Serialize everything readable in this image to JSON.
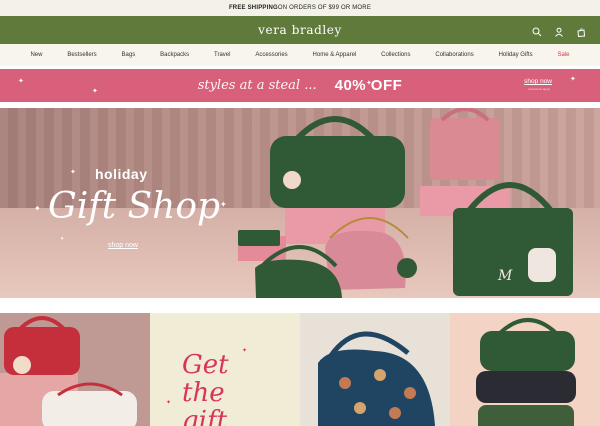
{
  "top_bar": {
    "bold": "FREE SHIPPING",
    "rest": " ON ORDERS OF $99 OR MORE"
  },
  "header": {
    "logo": "vera bradley",
    "icons": [
      "search-icon",
      "account-icon",
      "bag-icon"
    ]
  },
  "nav": [
    "New",
    "Bestsellers",
    "Bags",
    "Backpacks",
    "Travel",
    "Accessories",
    "Home & Apparel",
    "Collections",
    "Collaborations",
    "Holiday Gifts",
    "Sale"
  ],
  "promo": {
    "script": "styles at a steal ...",
    "headline": "40% OFF",
    "cta": "shop now",
    "cta_sub": "exclusions apply"
  },
  "hero": {
    "kicker": "holiday",
    "title": "Gift Shop",
    "cta": "shop now",
    "monogram": "M"
  },
  "tiles": {
    "tile2_line1": "Get",
    "tile2_line2": "the",
    "tile2_line3": "gift"
  },
  "colors": {
    "header_green": "#5f7a3a",
    "promo_pink": "#d9607a",
    "sale_red": "#d8355a",
    "bag_green": "#2f5a35"
  }
}
